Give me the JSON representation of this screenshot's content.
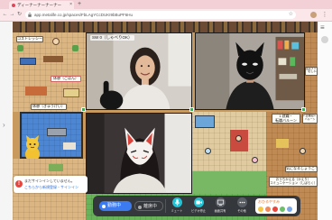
{
  "browser": {
    "tab_title": "ディーナーナーナーナー",
    "tab_close": "×",
    "new_tab": "+",
    "back": "←",
    "forward": "→",
    "reload": "↻",
    "url": "app.metalife.co.jp/spaces/FbLAgYCcDUKI9bBuPF6Hu",
    "star": "☆",
    "menu": "⋮"
  },
  "page": {
    "side_toggle": "›",
    "menu": "≡"
  },
  "map": {
    "signs": {
      "top_left": "コストレッシー",
      "lunch": "休憩（ごはん）",
      "rest": "休憩（きゅうけい）",
      "chat_title": "会話フリー",
      "chat_note": "（おしゃべりOK）",
      "job_line1": "1.就職・",
      "job_line2": "転職バルーン",
      "company_line1": "2.企業紹介・",
      "company_line2": "バルーン",
      "interest": "気になるしょうこう",
      "home_line1": "おうちかえる（かえり）",
      "home_line2": "コミュニケーション（しばらく）"
    }
  },
  "videos": {
    "tile1_label": "SW 0（しゃべりOK）"
  },
  "notice": {
    "message": "まだサインインしていません。",
    "link": "こちらから新規登録・サインイン"
  },
  "toolbar": {
    "working": "勤務中",
    "away": "離席中",
    "mute": "ミュート",
    "video_stop": "ビデオ停止",
    "screen_share": "画面共有",
    "more": "その他",
    "reaction_title": "おひるやすみ"
  },
  "colors": {
    "tab_pink": "#f3d0d6",
    "accent_blue": "#3c7af0",
    "toolbar_cyan": "#1fc3d4",
    "speaking_green": "#2fb84a",
    "toolbar_bg": "#34373c",
    "warning_red": "#e8453c"
  },
  "icons": [
    "favicon-icon",
    "back-icon",
    "forward-icon",
    "reload-icon",
    "lock-icon",
    "star-icon",
    "menu-icon",
    "warning-icon",
    "mic-icon",
    "camera-icon",
    "screen-share-icon",
    "more-icon"
  ]
}
